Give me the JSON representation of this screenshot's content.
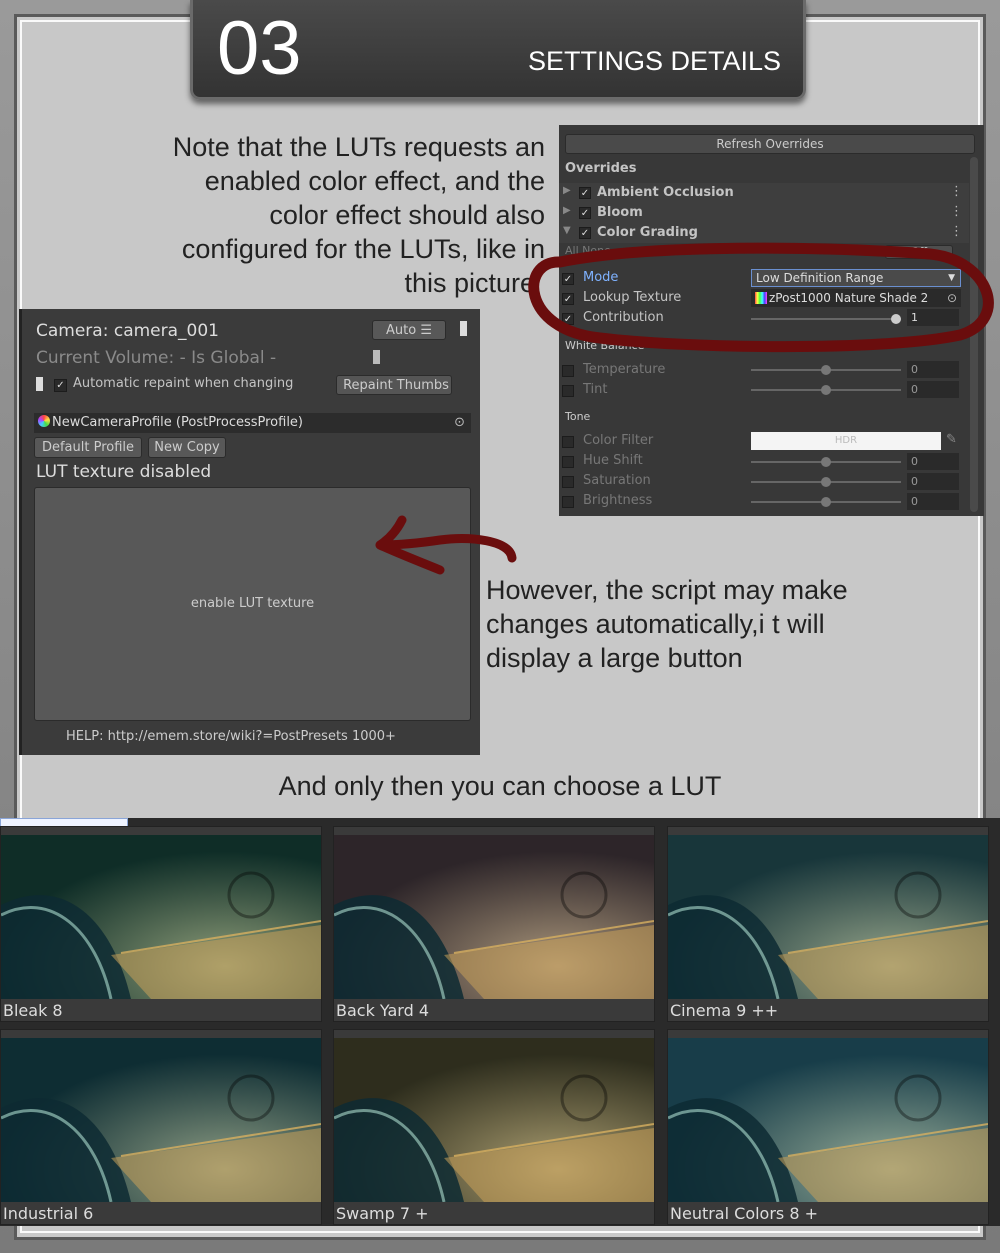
{
  "header": {
    "number": "03",
    "title": "SETTINGS DETAILS"
  },
  "notes": {
    "top": "Note that the LUTs requests an enabled color effect, and the color effect should also configured for the LUTs, like in this picture",
    "top_lines": [
      "Note that the LUTs requests an",
      "enabled color effect, and the",
      "color effect should also",
      "configured for the LUTs, like in",
      "this picture"
    ],
    "middle_lines": [
      "However, the script may make",
      "changes automatically,i t will",
      "display a large button"
    ],
    "bottom": "And only then you can choose a LUT"
  },
  "overrides_panel": {
    "refresh_button": "Refresh Overrides",
    "section_title": "Overrides",
    "effects": [
      {
        "label": "Ambient Occlusion",
        "enabled": true
      },
      {
        "label": "Bloom",
        "enabled": true
      },
      {
        "label": "Color Grading",
        "enabled": true
      }
    ],
    "all_none": "All  None",
    "off_label": "Off",
    "grading_rows": [
      {
        "label": "Mode",
        "value": "Low Definition Range"
      },
      {
        "label": "Lookup Texture",
        "value": "zPost1000 Nature Shade 2"
      },
      {
        "label": "Contribution",
        "value": "1"
      }
    ],
    "white_balance": "White Balance",
    "wb_rows": [
      {
        "label": "Temperature",
        "value": "0"
      },
      {
        "label": "Tint",
        "value": "0"
      }
    ],
    "tone": "Tone",
    "tone_rows": [
      {
        "label": "Color Filter",
        "value": "HDR"
      },
      {
        "label": "Hue Shift",
        "value": "0"
      },
      {
        "label": "Saturation",
        "value": "0"
      },
      {
        "label": "Brightness",
        "value": "0"
      }
    ]
  },
  "camera_panel": {
    "camera_label": "Camera: camera_001",
    "auto_button": "Auto",
    "volume_label": "Current Volume: - Is Global -",
    "auto_repaint": "Automatic repaint when changing",
    "repaint_button": "Repaint Thumbs",
    "profile": "NewCameraProfile (PostProcessProfile)",
    "default_profile": "Default Profile",
    "new_copy": "New Copy",
    "lut_disabled": "LUT texture disabled",
    "enable_button": "enable LUT texture",
    "help": "HELP: http://emem.store/wiki?=PostPresets 1000+"
  },
  "lut_grid": [
    {
      "label": "Bleak 8",
      "tint": "#1d5a4e"
    },
    {
      "label": "Back Yard 4",
      "tint": "#5a4a52"
    },
    {
      "label": "Cinema 9 ++",
      "tint": "#2f6b74"
    },
    {
      "label": "Industrial 6",
      "tint": "#1c5a66"
    },
    {
      "label": "Swamp 7 +",
      "tint": "#5b5a3a"
    },
    {
      "label": "Neutral Colors 8 +",
      "tint": "#2f7a92"
    }
  ],
  "colors": {
    "annotation_red": "#6a0d0d",
    "unity_panel": "#383838",
    "highlight_blue": "#7fb2ff"
  }
}
